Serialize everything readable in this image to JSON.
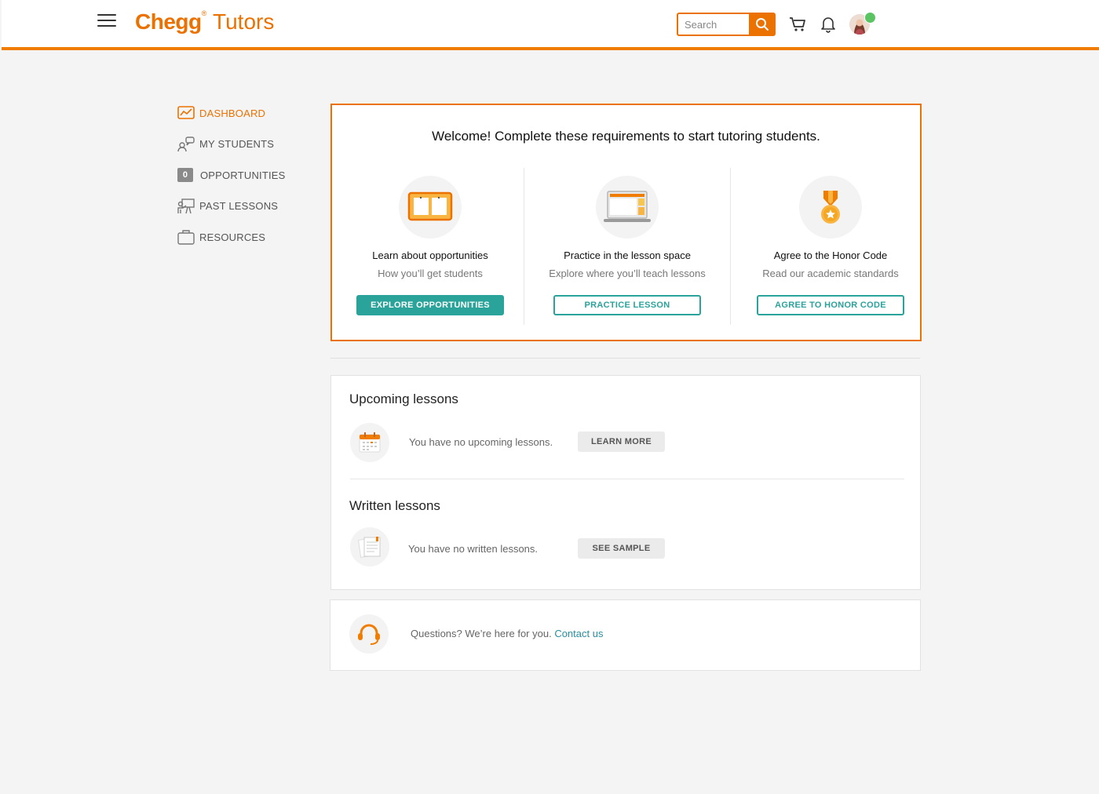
{
  "header": {
    "brand": "Chegg",
    "brand_mark": "®",
    "product": "Tutors",
    "search_placeholder": "Search"
  },
  "sidebar": {
    "items": [
      {
        "label": "DASHBOARD",
        "icon": "chart-icon",
        "active": true
      },
      {
        "label": "MY STUDENTS",
        "icon": "students-icon"
      },
      {
        "label": "OPPORTUNITIES",
        "icon": "count-badge",
        "count": "0"
      },
      {
        "label": "PAST LESSONS",
        "icon": "teacher-icon"
      },
      {
        "label": "RESOURCES",
        "icon": "briefcase-icon"
      }
    ]
  },
  "welcome": {
    "title": "Welcome! Complete these requirements to start tutoring students.",
    "steps": [
      {
        "title": "Learn about opportunities",
        "subtitle": "How you’ll get students",
        "button": "EXPLORE OPPORTUNITIES",
        "icon": "board-icon"
      },
      {
        "title": "Practice in the lesson space",
        "subtitle": "Explore where you’ll teach lessons",
        "button": "PRACTICE LESSON",
        "icon": "laptop-icon"
      },
      {
        "title": "Agree to the Honor Code",
        "subtitle": "Read our academic standards",
        "button": "AGREE TO HONOR CODE",
        "icon": "medal-icon"
      }
    ]
  },
  "lessons": {
    "upcoming": {
      "heading": "Upcoming lessons",
      "text": "You have no upcoming lessons.",
      "button": "LEARN MORE"
    },
    "written": {
      "heading": "Written lessons",
      "text": "You have no written lessons.",
      "button": "SEE SAMPLE"
    }
  },
  "contact": {
    "text": "Questions? We’re here for you.",
    "link": "Contact us"
  },
  "colors": {
    "brand_orange": "#eb7100",
    "teal": "#2aa39a",
    "online": "#5ac462"
  }
}
